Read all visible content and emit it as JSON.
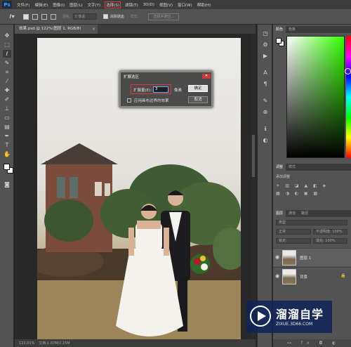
{
  "app": {
    "logo": "Ps"
  },
  "menubar": {
    "items": [
      "文件(F)",
      "编辑(E)",
      "图像(I)",
      "图层(L)",
      "文字(Y)",
      "选择(S)",
      "滤镜(T)",
      "3D(D)",
      "视图(V)",
      "窗口(W)",
      "帮助(H)"
    ],
    "active_index": 5
  },
  "options_bar": {
    "feather_label": "羽化:",
    "feather_value": "0 像素",
    "antialias_label": "消除锯齿",
    "style_label": "样式:",
    "select_subject_label": "选择并遮住..."
  },
  "document": {
    "tab_title": "效果.psd @ 122%(图层 1, RGB/8)",
    "close_glyph": "×"
  },
  "status_bar": {
    "zoom": "122.01%",
    "doc_info": "文档:1.07M/2.15M"
  },
  "dialog": {
    "title": "扩展选区",
    "close_glyph": "✕",
    "expand_label": "扩展量(E):",
    "expand_value": "3",
    "unit": "像素",
    "ok_label": "确定",
    "cancel_label": "取消",
    "checkbox_label": "应用画布边界的效果",
    "checkbox_checked": false
  },
  "panels": {
    "color_tabs": [
      "颜色",
      "色板"
    ],
    "adjust_tabs": [
      "调整",
      "样式"
    ],
    "adjust_title": "添加调整",
    "layer_tabs": [
      "图层",
      "通道",
      "路径"
    ],
    "kind_filter": "类型",
    "blend_mode": "正常",
    "opacity": "不透明度: 100%",
    "lock_label": "锁定:",
    "fill": "填充: 100%",
    "layers": [
      {
        "name": "图层 1",
        "selected": true,
        "locked": false
      },
      {
        "name": "背景",
        "selected": false,
        "locked": true
      }
    ],
    "colors": {
      "foreground": "#ffffff",
      "background": "#ffffff",
      "hue": "#33ff00"
    }
  },
  "watermark": {
    "title": "溜溜自学",
    "url": "ZIXUE.3D66.COM"
  }
}
